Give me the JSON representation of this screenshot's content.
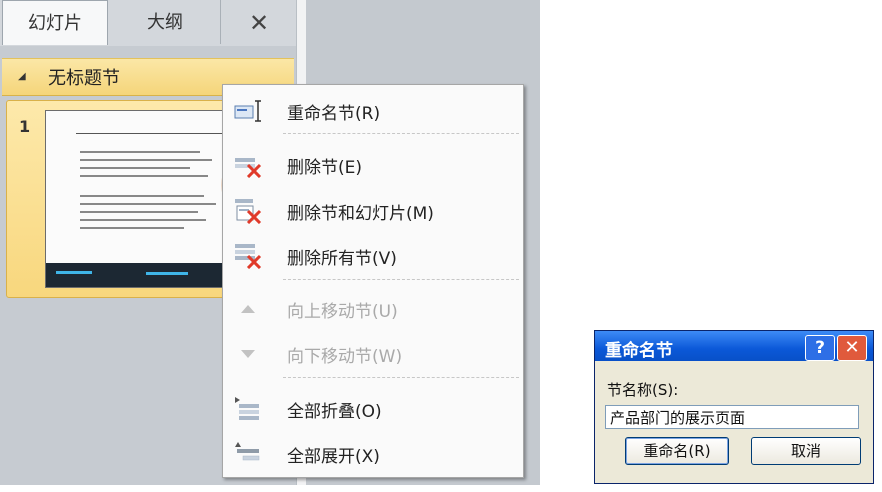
{
  "pane": {
    "tabs": {
      "slides": "幻灯片",
      "outline": "大纲",
      "close": "✕"
    },
    "section": {
      "name": "无标题节"
    },
    "slide": {
      "number": "1"
    }
  },
  "menu": {
    "items": [
      {
        "label": "重命名节(R)",
        "icon": "rename-section-icon",
        "enabled": true
      },
      {
        "label": "删除节(E)",
        "icon": "delete-section-icon",
        "enabled": true
      },
      {
        "label": "删除节和幻灯片(M)",
        "icon": "delete-section-slides-icon",
        "enabled": true
      },
      {
        "label": "删除所有节(V)",
        "icon": "delete-all-sections-icon",
        "enabled": true
      },
      {
        "label": "向上移动节(U)",
        "icon": "move-up-icon",
        "enabled": false
      },
      {
        "label": "向下移动节(W)",
        "icon": "move-down-icon",
        "enabled": false
      },
      {
        "label": "全部折叠(O)",
        "icon": "collapse-all-icon",
        "enabled": true
      },
      {
        "label": "全部展开(X)",
        "icon": "expand-all-icon",
        "enabled": true
      }
    ]
  },
  "dialog": {
    "title": "重命名节",
    "help": "?",
    "close": "✕",
    "field_label": "节名称(S):",
    "field_value": "产品部门的展示页面",
    "ok_label": "重命名(R)",
    "cancel_label": "取消"
  },
  "colors": {
    "accent_gold": "#f8d77d",
    "dialog_blue": "#0b58d8",
    "delete_red": "#e03a2a"
  }
}
